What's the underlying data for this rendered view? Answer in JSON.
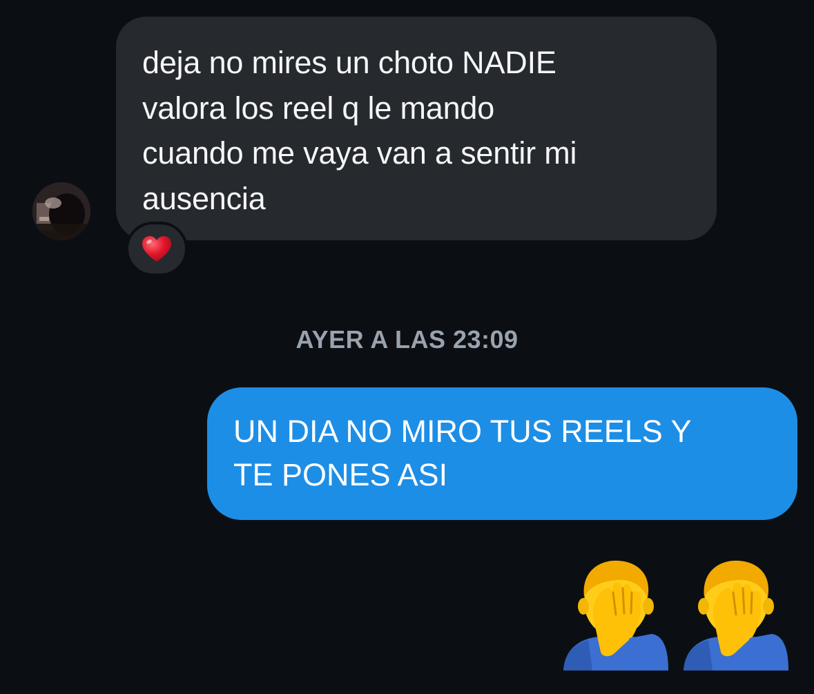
{
  "chat": {
    "incoming": {
      "text": "deja no mires un choto NADIE\nvalora los reel q le mando\ncuando me vaya van a sentir mi\nausencia",
      "reaction": "heart-emoji",
      "avatar": "contact-avatar"
    },
    "timestamp": "AYER A LAS 23:09",
    "outgoing": {
      "text": "UN DIA NO MIRO TUS REELS Y\nTE PONES ASI"
    },
    "emoji_message": [
      "man-facepalming-emoji",
      "man-facepalming-emoji"
    ]
  },
  "colors": {
    "background": "#0b0f14",
    "incoming_bubble": "#262a2f",
    "outgoing_bubble": "#1d8ee6",
    "timestamp": "#9aa2ad",
    "heart": "#e0162b"
  }
}
